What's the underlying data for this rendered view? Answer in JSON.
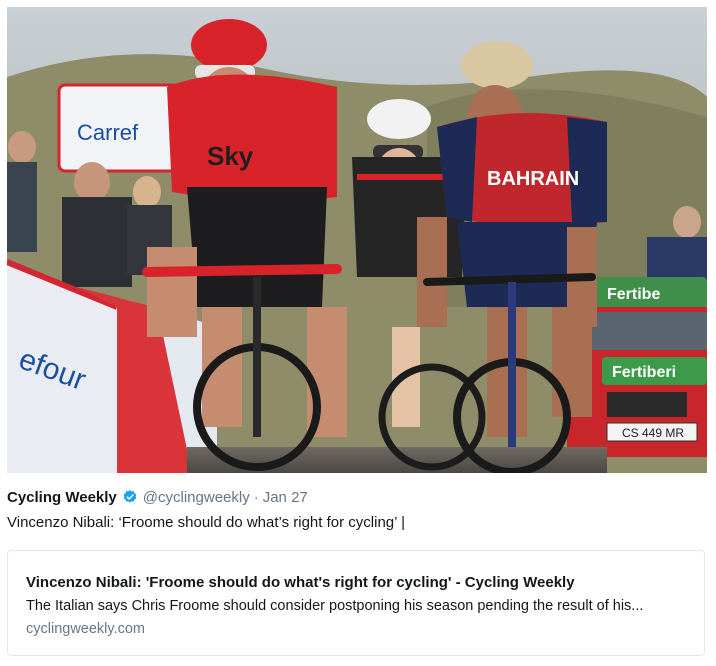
{
  "tweet": {
    "author_name": "Cycling Weekly",
    "handle": "@cyclingweekly",
    "separator": "·",
    "date": "Jan 27",
    "text": "Vincenzo Nibali: ‘Froome should do what’s right for cycling’ |",
    "verified": true
  },
  "photo": {
    "banner_text_top": "Carref",
    "barrier_text": "efour",
    "car_banner": "Fertibe",
    "car_door_text": "Fertiberi",
    "plate": "CS 449 MR",
    "jersey_left_text": "Sky",
    "jersey_right_text": "BAHRAIN"
  },
  "card": {
    "title": "Vincenzo Nibali: 'Froome should do what's right for cycling' - Cycling Weekly",
    "description": "The Italian says Chris Froome should consider postponing his season pending the result of his...",
    "domain": "cyclingweekly.com"
  },
  "colors": {
    "verified_blue": "#1da1f2",
    "muted": "#657786",
    "text": "#14171a",
    "jersey_red": "#d8232a",
    "bahrain_red": "#c0272d"
  }
}
